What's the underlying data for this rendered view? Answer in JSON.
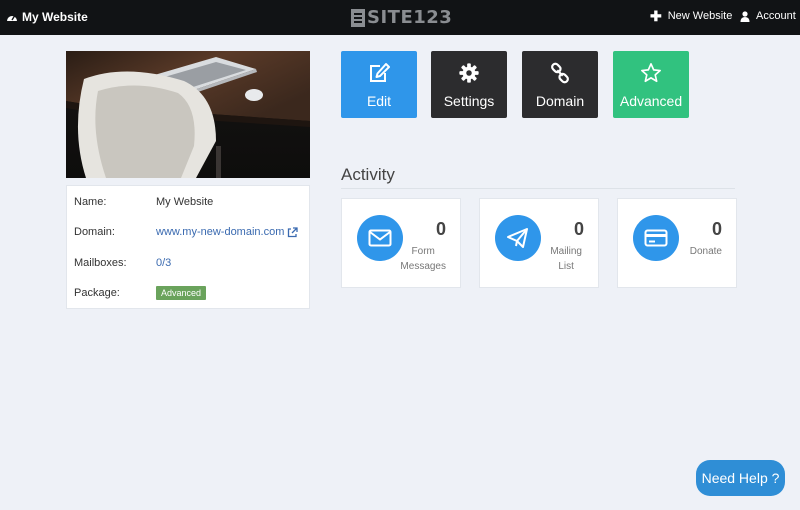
{
  "topbar": {
    "site_name": "My Website",
    "logo_text": "SITE123",
    "new_website_label": "New Website",
    "account_label": "Account"
  },
  "info": {
    "name_label": "Name:",
    "name_value": "My Website",
    "domain_label": "Domain:",
    "domain_value": "www.my-new-domain.com",
    "mailboxes_label": "Mailboxes:",
    "mailboxes_value": "0/3",
    "package_label": "Package:",
    "package_value": "Advanced"
  },
  "actions": {
    "edit": "Edit",
    "settings": "Settings",
    "domain": "Domain",
    "advanced": "Advanced"
  },
  "activity": {
    "title": "Activity",
    "stats": [
      {
        "count": "0",
        "label_line1": "Form",
        "label_line2": "Messages",
        "icon": "envelope-icon"
      },
      {
        "count": "0",
        "label_line1": "Mailing",
        "label_line2": "List",
        "icon": "paper-plane-icon"
      },
      {
        "count": "0",
        "label_line1": "Donate",
        "label_line2": "",
        "icon": "credit-card-icon"
      }
    ]
  },
  "help": {
    "label": "Need Help ?"
  },
  "colors": {
    "topbar": "#111315",
    "accent_blue": "#2f96ea",
    "dark_button": "#2c2c2e",
    "green_button": "#31c27f",
    "badge_green": "#6aa35c",
    "link": "#3a6ab0",
    "page_bg": "#eef1f7"
  }
}
